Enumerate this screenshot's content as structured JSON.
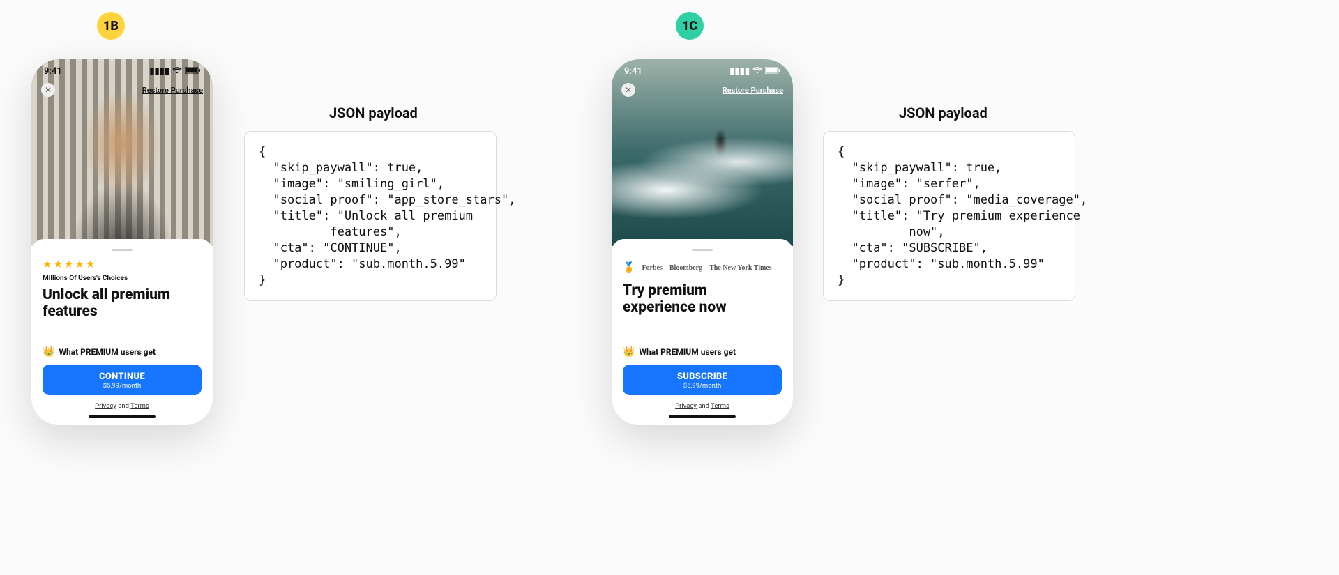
{
  "badges": {
    "b": "1B",
    "c": "1C"
  },
  "status_time": "9:41",
  "restore_label": "Restore Purchase",
  "benefit_label": "What PREMIUM users get",
  "legal": {
    "privacy": "Privacy",
    "and": " and ",
    "terms": "Terms"
  },
  "variantB": {
    "caption": "Millions Of Users's Choices",
    "title": "Unlock all premium features",
    "cta": "CONTINUE",
    "price": "$5,99/month"
  },
  "variantC": {
    "title": "Try premium experience now",
    "cta": "SUBSCRIBE",
    "price": "$5,99/month",
    "logos": [
      "Forbes",
      "Bloomberg",
      "The New York Times"
    ]
  },
  "payload_title": "JSON payload",
  "payloadB": "{\n  \"skip_paywall\": true,\n  \"image\": \"smiling_girl\",\n  \"social proof\": \"app_store_stars\",\n  \"title\": \"Unlock all premium\n          features\",\n  \"cta\": \"CONTINUE\",\n  \"product\": \"sub.month.5.99\"\n}",
  "payloadC": "{\n  \"skip_paywall\": true,\n  \"image\": \"serfer\",\n  \"social proof\": \"media_coverage\",\n  \"title\": \"Try premium experience\n          now\",\n  \"cta\": \"SUBSCRIBE\",\n  \"product\": \"sub.month.5.99\"\n}"
}
